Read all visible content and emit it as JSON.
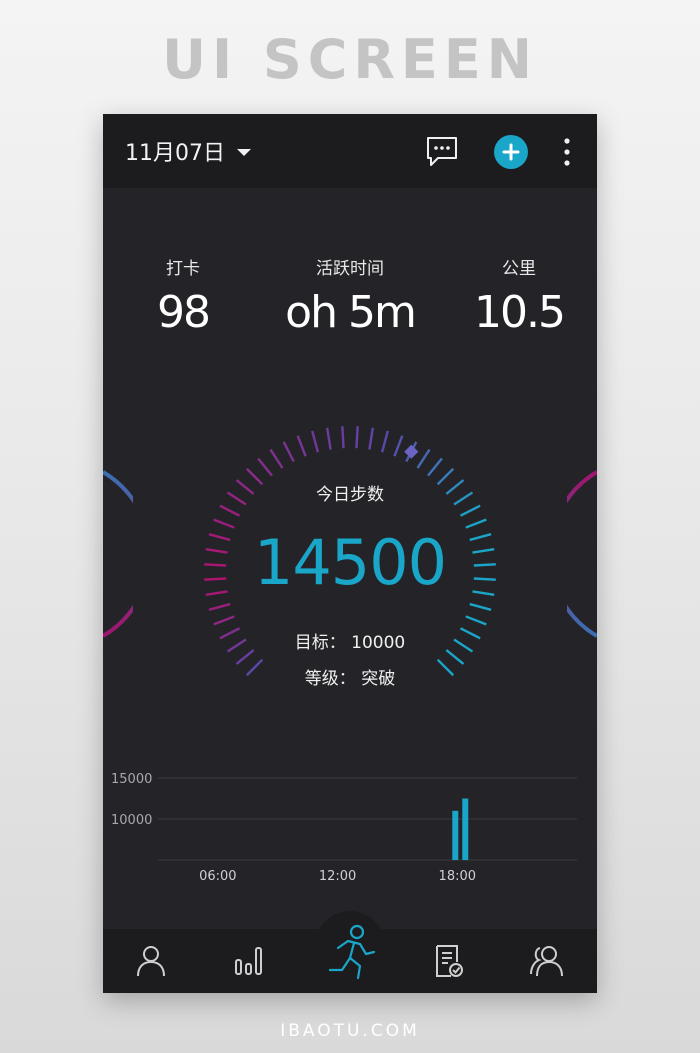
{
  "banner": "UI SCREEN",
  "footer": "IBAOTU.COM",
  "header": {
    "date": "11月07日",
    "icons": [
      "chat-bubble-icon",
      "plus-icon",
      "more-vertical-icon"
    ],
    "accent": "#1aa6c8"
  },
  "stats": [
    {
      "label": "打卡",
      "value": "98"
    },
    {
      "label": "活跃时间",
      "value": "oh 5m"
    },
    {
      "label": "公里",
      "value": "10.5"
    }
  ],
  "gauge": {
    "title": "今日步数",
    "steps": "14500",
    "goal_line": "目标： 10000",
    "level_line": "等级： 突破"
  },
  "chart_data": {
    "type": "bar",
    "y_ticks": [
      "15000",
      "10000"
    ],
    "x_ticks": [
      "06:00",
      "12:00",
      "18:00"
    ],
    "bars": [
      {
        "hour": 17.9,
        "value": 11000
      },
      {
        "hour": 18.4,
        "value": 12500
      }
    ],
    "y_base": 5000,
    "y_max": 15000,
    "x_range": [
      3,
      24
    ],
    "bar_color": "#1aa6c8"
  },
  "nav": {
    "items": [
      "profile-icon",
      "bar-chart-icon",
      "running-icon",
      "checklist-icon",
      "friends-icon"
    ],
    "active": "running-icon"
  }
}
